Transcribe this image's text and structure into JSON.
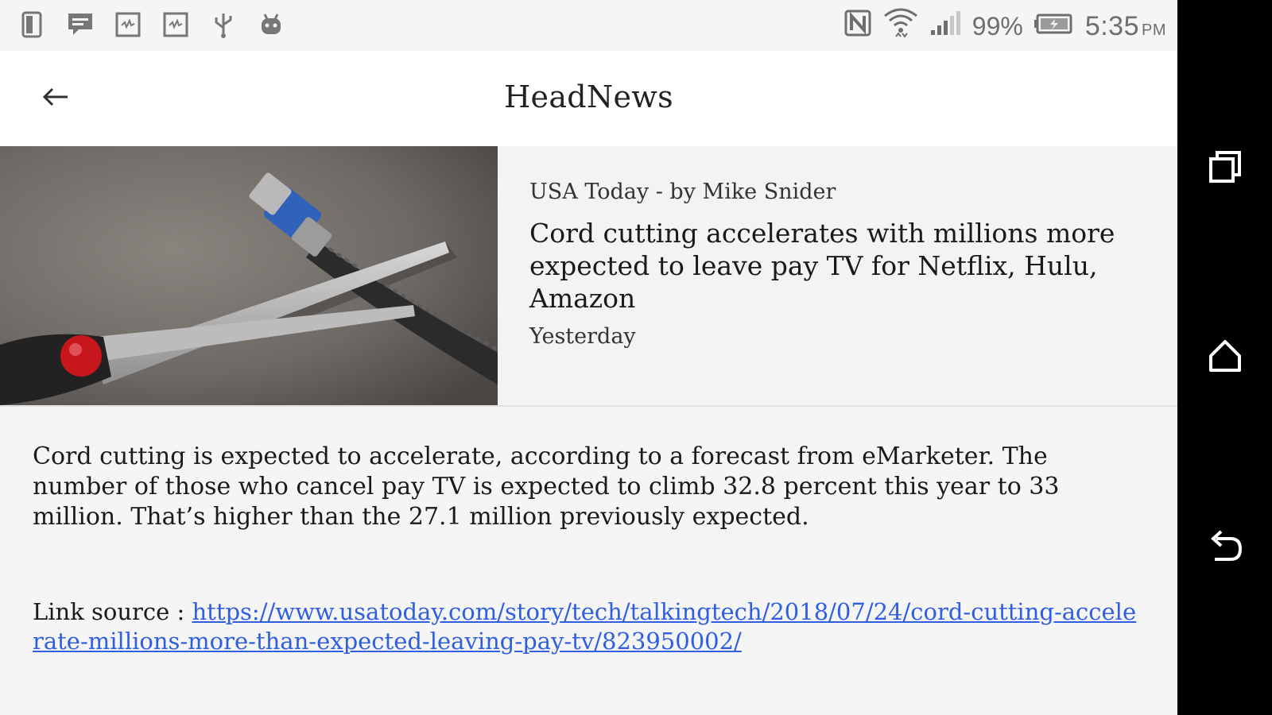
{
  "status_bar": {
    "left_icons": [
      "phone-portrait-icon",
      "chat-bubble-icon",
      "code-image-icon",
      "code-image-icon",
      "usb-icon",
      "android-icon"
    ],
    "battery": "99%",
    "time": "5:35",
    "ampm": "PM"
  },
  "app_bar": {
    "title": "HeadNews"
  },
  "article": {
    "source": "USA Today - by Mike Snider",
    "headline": "Cord cutting accelerates with millions more expected to leave pay TV for Netflix, Hulu, Amazon",
    "date": "Yesterday",
    "body": "Cord cutting is expected to accelerate, according to a forecast from eMarketer. The number of those who cancel pay TV is expected to climb 32.8 percent this year to 33 million. That’s higher than the 27.1 million previously expected.",
    "link_label": "Link source : ",
    "link_url": "https://www.usatoday.com/story/tech/talkingtech/2018/07/24/cord-cutting-accelerate-millions-more-than-expected-leaving-pay-tv/823950002/"
  },
  "nav_bar": {
    "buttons": [
      "recents-icon",
      "home-icon",
      "back-icon"
    ]
  }
}
